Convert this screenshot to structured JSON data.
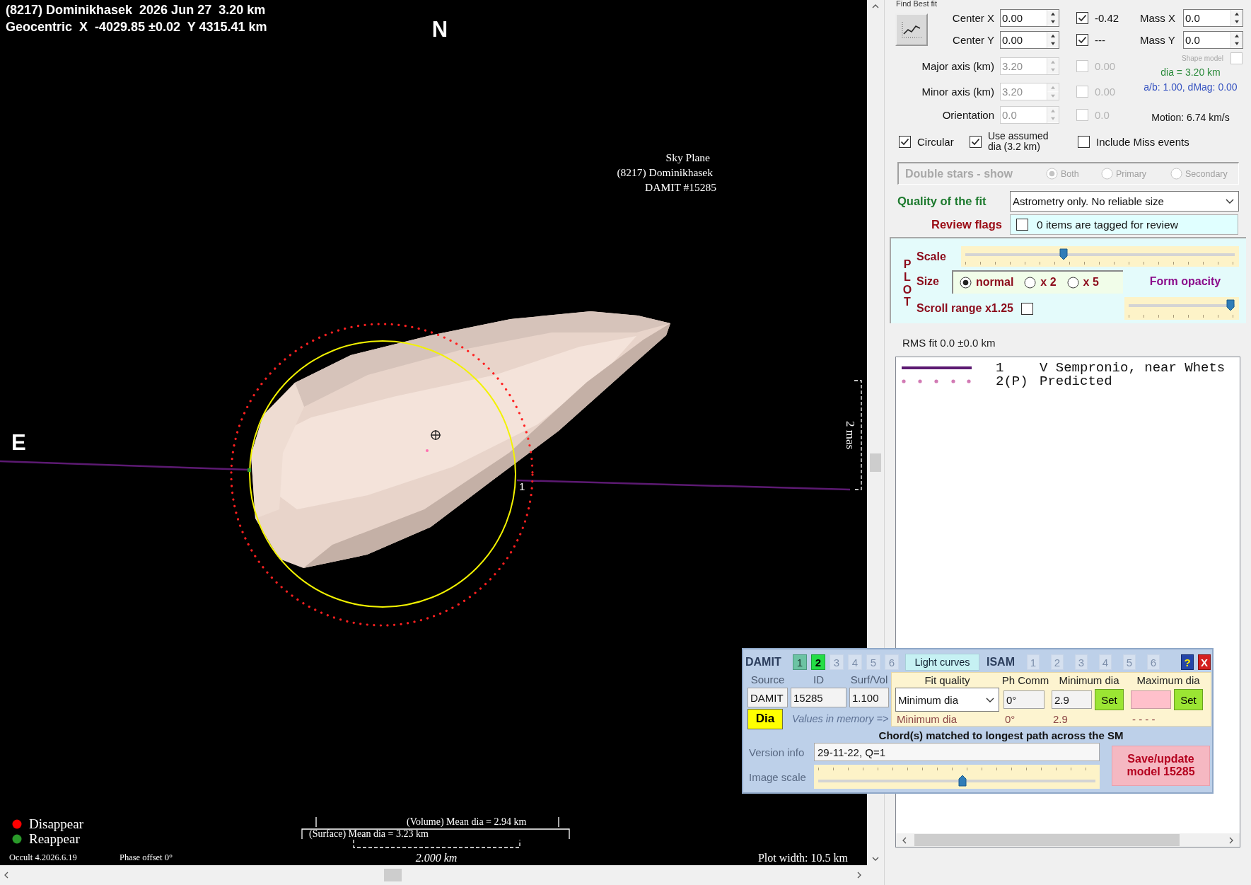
{
  "plot": {
    "title": "(8217) Dominikhasek  2026 Jun 27  3.20 km",
    "position": "Geocentric  X  -4029.85 ±0.02  Y 4315.41 km",
    "north": "N",
    "east": "E",
    "sky_plane": [
      "Sky Plane",
      "(8217) Dominikhasek",
      "DAMIT #15285"
    ],
    "chord_number": "1",
    "angular_scale": "2 mas",
    "legend": [
      {
        "label": "Disappear",
        "color": "#ff0000"
      },
      {
        "label": "Reappear",
        "color": "#2a9a2a"
      }
    ],
    "program_version": "Occult 4.2026.6.19",
    "phase_offset": "Phase offset 0°",
    "volume_dia": "(Volume) Mean dia = 2.94 km",
    "surface_dia": "(Surface) Mean dia = 3.23 km",
    "distance_scale": "2.000 km",
    "plot_width": "Plot width: 10.5 km"
  },
  "fit": {
    "group_label": "Find Best fit",
    "rows": [
      {
        "label": "Center X",
        "value": "0.00",
        "disabled": false,
        "checked": true,
        "result": "-0.42"
      },
      {
        "label": "Center Y",
        "value": "0.00",
        "disabled": false,
        "checked": true,
        "result": "---"
      },
      {
        "label": "Major axis (km)",
        "value": "3.20",
        "disabled": true,
        "checked": false,
        "result": "0.00"
      },
      {
        "label": "Minor axis (km)",
        "value": "3.20",
        "disabled": true,
        "checked": false,
        "result": "0.00"
      },
      {
        "label": "Orientation",
        "value": "0.0",
        "disabled": true,
        "checked": false,
        "result": "0.0"
      }
    ],
    "mass": [
      {
        "label": "Mass X",
        "value": "0.0"
      },
      {
        "label": "Mass Y",
        "value": "0.0"
      }
    ],
    "shape_model": {
      "label": "Shape model",
      "checked": false,
      "disabled": true
    },
    "dia": "dia = 3.20 km",
    "ratio": "a/b: 1.00, dMag: 0.00",
    "motion": "Motion: 6.74 km/s",
    "options": [
      {
        "label": "Circular",
        "checked": true
      },
      {
        "label": "Use assumed dia (3.2 km)",
        "checked": true
      },
      {
        "label": "Include Miss events",
        "checked": false
      }
    ]
  },
  "double_stars": {
    "label": "Double stars - show",
    "disabled": true,
    "options": [
      {
        "label": "Both",
        "selected": true
      },
      {
        "label": "Primary",
        "selected": false
      },
      {
        "label": "Secondary",
        "selected": false
      }
    ]
  },
  "quality": {
    "label": "Quality of the fit",
    "value": "Astrometry only. No reliable size"
  },
  "review": {
    "label": "Review flags",
    "checked": false,
    "text": "0 items are tagged for review"
  },
  "plot_settings": {
    "label": "PLOT",
    "scale": {
      "label": "Scale",
      "level": 0.36
    },
    "size": {
      "label": "Size",
      "options": [
        {
          "label": "normal",
          "selected": true
        },
        {
          "label": "x 2",
          "selected": false
        },
        {
          "label": "x 5",
          "selected": false
        }
      ]
    },
    "opacity": {
      "label": "Form opacity",
      "level": 1
    },
    "scroll_range": {
      "label": "Scroll range x1.25",
      "checked": false
    }
  },
  "rms": "RMS fit 0.0 ±0.0 km",
  "chords": [
    {
      "kind": "line",
      "number": "1",
      "name": "V Sempronio, near Whets",
      "color": "#5c1a72"
    },
    {
      "kind": "dots",
      "number": "2(P)",
      "name": "Predicted",
      "color": "#d27ab4"
    }
  ],
  "damit": {
    "title": "DAMIT",
    "models": [
      {
        "label": "1",
        "selected": false,
        "disabled": false
      },
      {
        "label": "2",
        "selected": true,
        "disabled": false
      },
      {
        "label": "3",
        "selected": false,
        "disabled": true
      },
      {
        "label": "4",
        "selected": false,
        "disabled": true
      },
      {
        "label": "5",
        "selected": false,
        "disabled": true
      },
      {
        "label": "6",
        "selected": false,
        "disabled": true
      }
    ],
    "light_curves": "Light curves",
    "isam_title": "ISAM",
    "isam_models": [
      {
        "label": "1",
        "selected": false,
        "disabled": true
      },
      {
        "label": "2",
        "selected": false,
        "disabled": true
      },
      {
        "label": "3",
        "selected": false,
        "disabled": true
      },
      {
        "label": "4",
        "selected": false,
        "disabled": true
      },
      {
        "label": "5",
        "selected": false,
        "disabled": true
      },
      {
        "label": "6",
        "selected": false,
        "disabled": true
      }
    ],
    "help": "?",
    "close": "X",
    "columns": [
      {
        "label": "Source",
        "value": "DAMIT"
      },
      {
        "label": "ID",
        "value": "15285"
      },
      {
        "label": "Surf/Vol",
        "value": "1.100"
      }
    ],
    "dia_button": "Dia",
    "memory_hint": "Values in memory =>",
    "fit_quality": {
      "label": "Fit quality",
      "value": "Minimum dia",
      "memory": "Minimum dia"
    },
    "phase_correction": {
      "label": "Ph Comm",
      "value": "0°",
      "memory": "0°"
    },
    "min_dia": {
      "label": "Minimum dia",
      "value": "2.9",
      "memory": "2.9",
      "button": "Set"
    },
    "max_dia": {
      "label": "Maximum dia",
      "memory": "- - - -",
      "button": "Set"
    },
    "chord_note": "Chord(s) matched to longest path across the SM",
    "version": {
      "label": "Version info",
      "value": "29-11-22, Q=1"
    },
    "image_scale": {
      "label": "Image scale",
      "level": 0.52
    },
    "save_button": "Save/update model 15285"
  }
}
